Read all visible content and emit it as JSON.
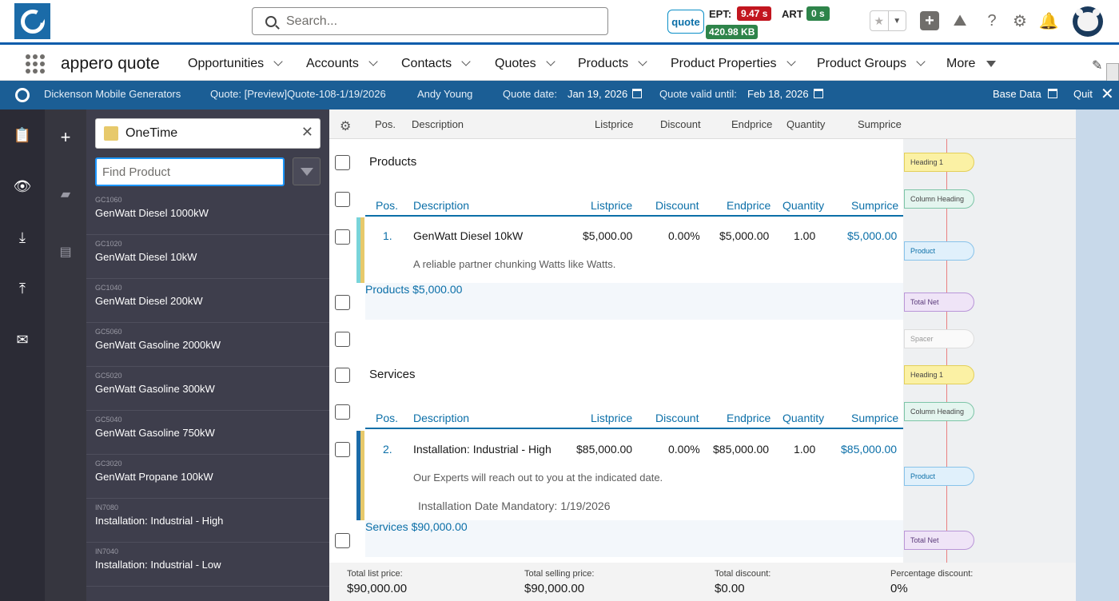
{
  "header": {
    "search_placeholder": "Search...",
    "quote_badge": "quote",
    "ept_label": "EPT:",
    "ept_value": "9.47 s",
    "kb_value": "420.98 KB",
    "art_label": "ART",
    "art_value": "0 s"
  },
  "nav": {
    "app_name": "appero quote",
    "items": [
      {
        "label": "Opportunities"
      },
      {
        "label": "Accounts"
      },
      {
        "label": "Contacts"
      },
      {
        "label": "Quotes"
      },
      {
        "label": "Products"
      },
      {
        "label": "Product Properties"
      },
      {
        "label": "Product Groups"
      },
      {
        "label": "More"
      }
    ]
  },
  "quotebar": {
    "account": "Dickenson Mobile Generators",
    "quote": "Quote: [Preview]Quote-108-1/19/2026",
    "owner": "Andy Young",
    "quote_date_label": "Quote date:",
    "quote_date": "Jan 19, 2026",
    "valid_label": "Quote valid until:",
    "valid_date": "Feb 18, 2026",
    "base_data": "Base Data",
    "quit": "Quit"
  },
  "panel": {
    "pricebook": "OneTime",
    "find_placeholder": "Find Product",
    "products": [
      {
        "code": "GC1060",
        "name": "GenWatt Diesel 1000kW"
      },
      {
        "code": "GC1020",
        "name": "GenWatt Diesel 10kW"
      },
      {
        "code": "GC1040",
        "name": "GenWatt Diesel 200kW"
      },
      {
        "code": "GC5060",
        "name": "GenWatt Gasoline 2000kW"
      },
      {
        "code": "GC5020",
        "name": "GenWatt Gasoline 300kW"
      },
      {
        "code": "GC5040",
        "name": "GenWatt Gasoline 750kW"
      },
      {
        "code": "GC3020",
        "name": "GenWatt Propane 100kW"
      },
      {
        "code": "IN7080",
        "name": "Installation: Industrial - High"
      },
      {
        "code": "IN7040",
        "name": "Installation: Industrial - Low"
      }
    ]
  },
  "grid": {
    "head": {
      "pos": "Pos.",
      "description": "Description",
      "listprice": "Listprice",
      "discount": "Discount",
      "endprice": "Endprice",
      "quantity": "Quantity",
      "sumprice": "Sumprice"
    },
    "pills": {
      "heading": "Heading 1",
      "column": "Column Heading",
      "product": "Product",
      "total": "Total Net",
      "spacer": "Spacer"
    },
    "section1": {
      "title": "Products",
      "item": {
        "pos": "1.",
        "desc": "GenWatt Diesel 10kW",
        "listprice": "$5,000.00",
        "discount": "0.00%",
        "endprice": "$5,000.00",
        "qty": "1.00",
        "sum": "$5,000.00",
        "sub": "A reliable partner chunking Watts like Watts."
      },
      "total_label": "Products",
      "total_value": "$5,000.00"
    },
    "section2": {
      "title": "Services",
      "item": {
        "pos": "2.",
        "desc": "Installation: Industrial - High",
        "listprice": "$85,000.00",
        "discount": "0.00%",
        "endprice": "$85,000.00",
        "qty": "1.00",
        "sum": "$85,000.00",
        "sub": "Our Experts will reach out to you at the indicated date.",
        "note": "Installation Date Mandatory: 1/19/2026"
      },
      "total_label": "Services",
      "total_value": "$90,000.00"
    }
  },
  "footer": {
    "list_label": "Total list price:",
    "list_value": "$90,000.00",
    "selling_label": "Total selling price:",
    "selling_value": "$90,000.00",
    "discount_label": "Total discount:",
    "discount_value": "$0.00",
    "pct_label": "Percentage discount:",
    "pct_value": "0%"
  }
}
